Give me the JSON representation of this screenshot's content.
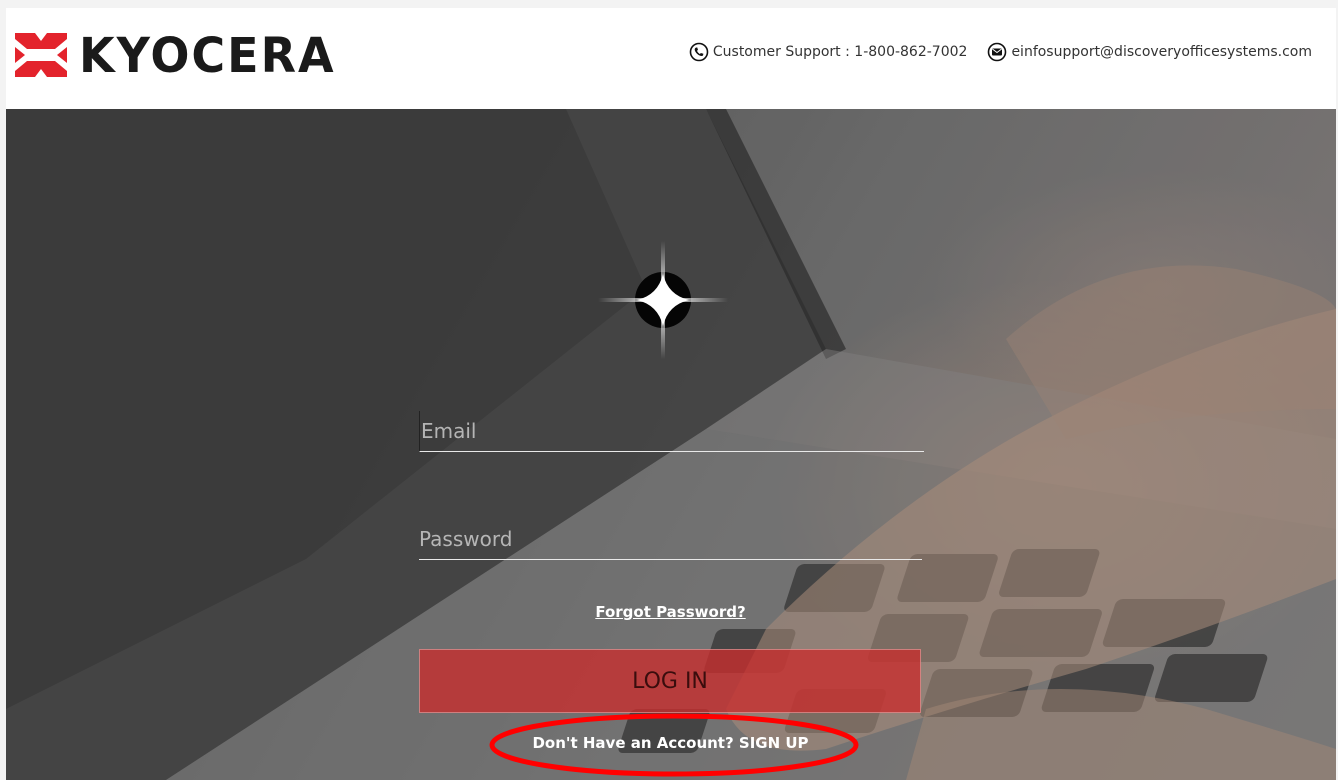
{
  "brand": {
    "name": "KYOCERA",
    "accent": "#e3232c"
  },
  "header": {
    "support_label": "Customer Support : 1-800-862-7002",
    "email": "einfosupport@discoveryofficesystems.com",
    "phone_icon": "phone-icon",
    "mail_icon": "mail-icon"
  },
  "form": {
    "email_placeholder": "Email",
    "password_placeholder": "Password",
    "forgot_label": "Forgot Password?",
    "login_label": "LOG IN",
    "signup_label": "Don't Have an Account? SIGN UP",
    "login_color": "#c92d2d"
  },
  "annotation": {
    "highlight_color": "#ff0000"
  }
}
